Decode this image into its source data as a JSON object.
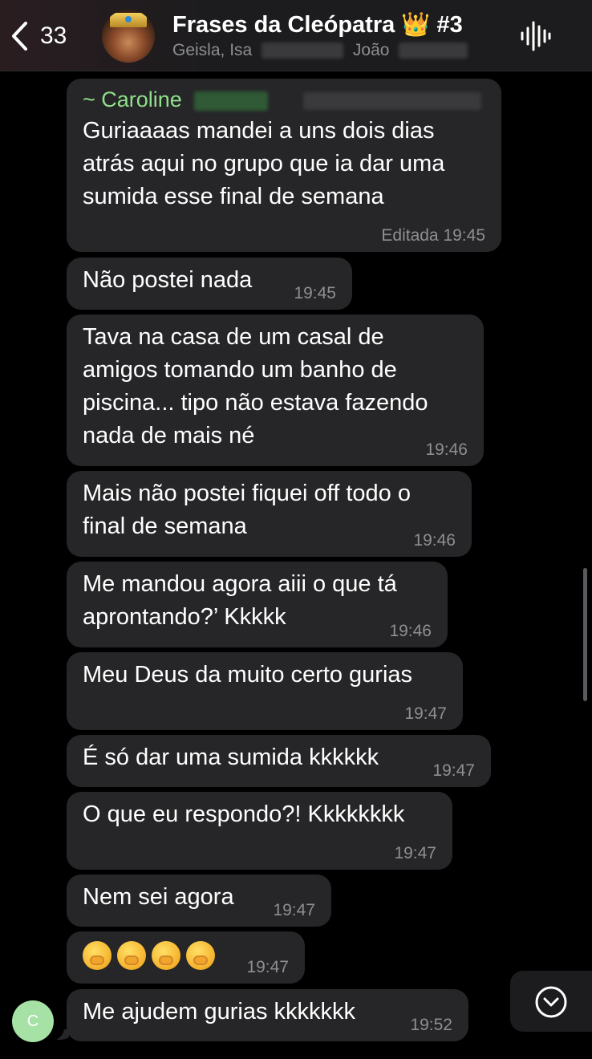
{
  "header": {
    "back_count": "33",
    "title": "Frases da Cleópatra 👑 #3",
    "members": [
      "Geisla, Isa",
      "João"
    ]
  },
  "messages": [
    {
      "sender": "~ Caroline",
      "text": "Guriaaaas mandei a uns dois dias\natrás aqui no grupo que ia dar uma\nsumida esse final de semana",
      "time": "Editada 19:45"
    },
    {
      "text": "Não postei nada",
      "time": "19:45"
    },
    {
      "text": "Tava na casa de um casal de\namigos tomando um banho de\npiscina... tipo não estava fazendo\nnada de mais né",
      "time": "19:46"
    },
    {
      "text": "Mais não postei fiquei off todo o\nfinal de semana",
      "time": "19:46"
    },
    {
      "text": "Me mandou agora aiii o que tá\naprontando?’ Kkkkk",
      "time": "19:46"
    },
    {
      "text": "Meu Deus da muito certo gurias",
      "time": "19:47"
    },
    {
      "text": "É só dar uma sumida kkkkkk",
      "time": "19:47"
    },
    {
      "text": "O que eu respondo?! Kkkkkkkk",
      "time": "19:47"
    },
    {
      "text": "Nem sei agora",
      "time": "19:47"
    },
    {
      "emojis": [
        "face-with-hands-over-eyes",
        "hand-over-mouth-face",
        "hand-over-mouth-face",
        "hand-over-mouth-face"
      ],
      "time": "19:47"
    },
    {
      "text": "Me ajudem gurias kkkkkkk",
      "time": "19:52"
    }
  ],
  "sender_avatar_initial": "C",
  "icons": {
    "back": "chevron-left-icon",
    "voice": "waveform-icon",
    "scroll_down": "chevron-down-circle-icon"
  },
  "colors": {
    "background": "#000000",
    "bubble": "#262628",
    "sender_name": "#8fe08a",
    "timestamp": "#8e8e93"
  }
}
